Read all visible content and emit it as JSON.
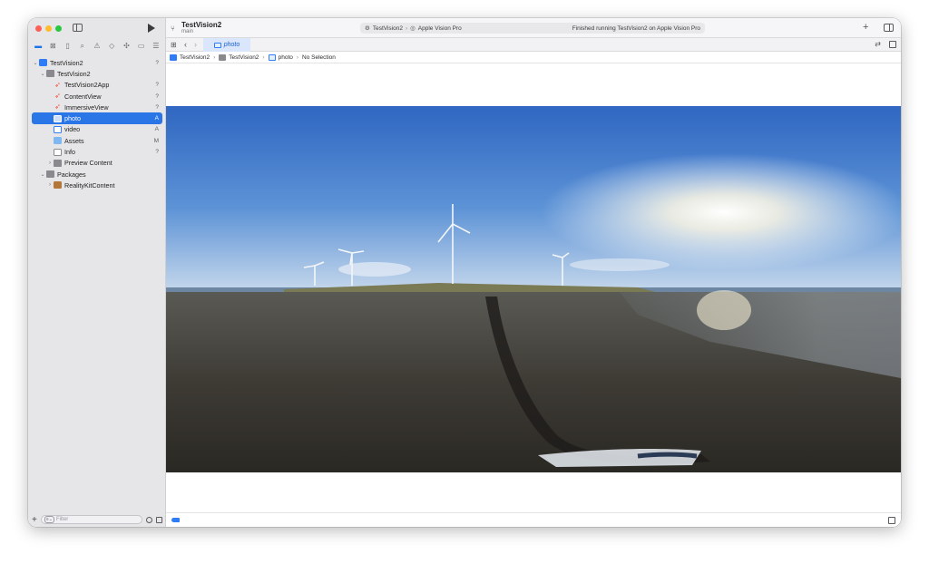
{
  "toolbar": {
    "project_title": "TestVision2",
    "branch": "main",
    "activity": {
      "scheme": "TestVision2",
      "destination": "Apple Vision Pro",
      "status": "Finished running TestVision2 on Apple Vision Pro"
    }
  },
  "tabbar": {
    "active_tab": "photo"
  },
  "breadcrumb": [
    "TestVision2",
    "TestVision2",
    "photo",
    "No Selection"
  ],
  "navigator": {
    "items": [
      {
        "label": "TestVision2",
        "status": "?"
      },
      {
        "label": "TestVision2",
        "status": ""
      },
      {
        "label": "TestVision2App",
        "status": "?"
      },
      {
        "label": "ContentView",
        "status": "?"
      },
      {
        "label": "ImmersiveView",
        "status": "?"
      },
      {
        "label": "photo",
        "status": "A"
      },
      {
        "label": "video",
        "status": "A"
      },
      {
        "label": "Assets",
        "status": "M"
      },
      {
        "label": "Info",
        "status": "?"
      },
      {
        "label": "Preview Content",
        "status": ""
      },
      {
        "label": "Packages",
        "status": ""
      },
      {
        "label": "RealityKitContent",
        "status": ""
      }
    ]
  },
  "filter": {
    "placeholder": "Filter"
  },
  "colors": {
    "accent": "#2a76e7",
    "sidebar_bg": "#e6e5e7",
    "swift": "#f05138"
  }
}
